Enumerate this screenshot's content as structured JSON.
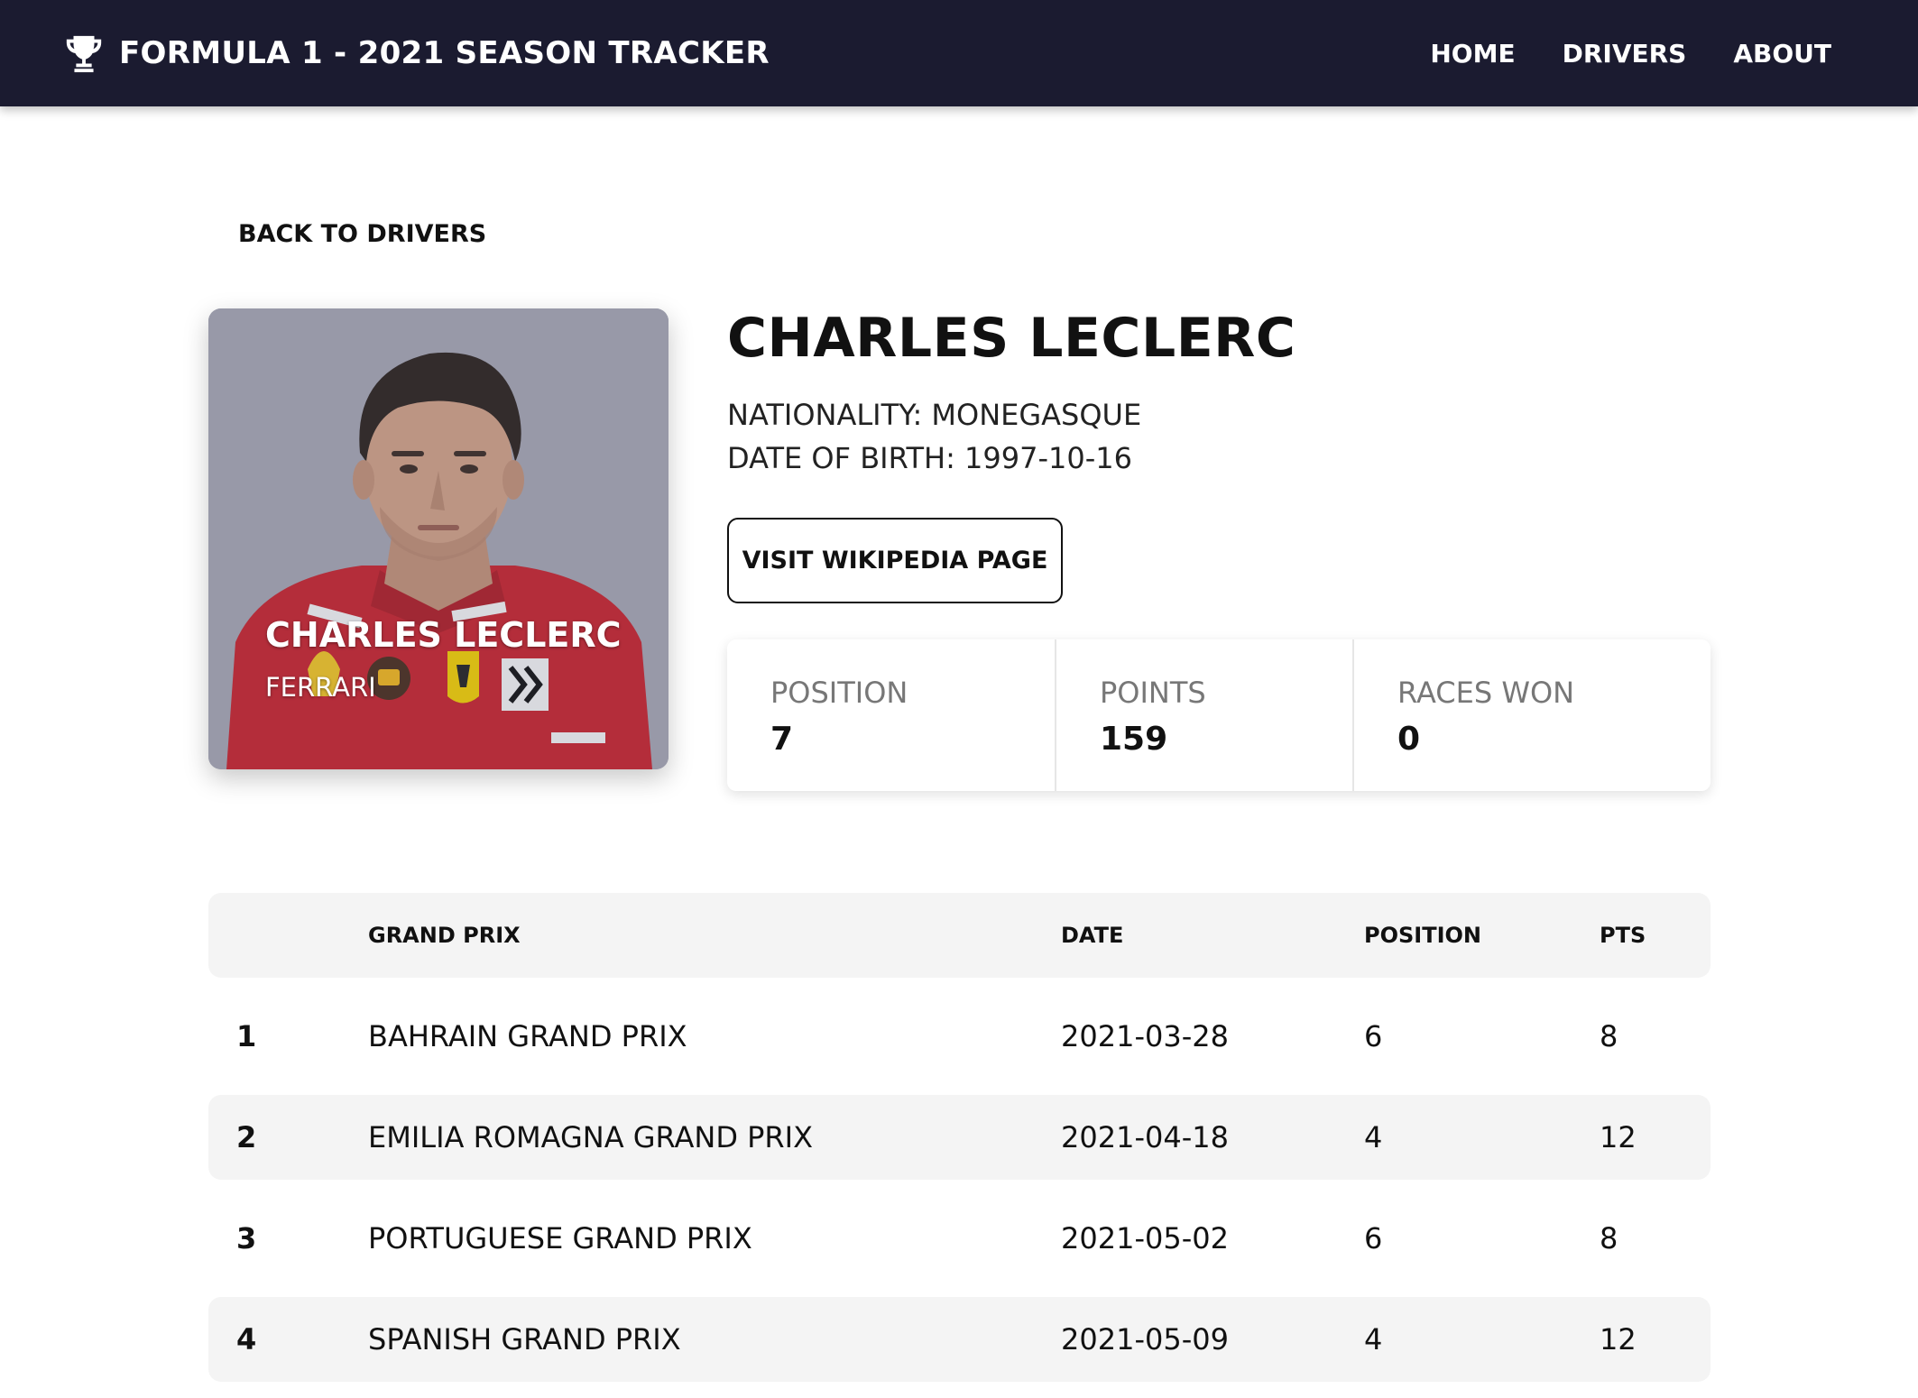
{
  "navbar": {
    "brand": "FORMULA 1 - 2021 SEASON TRACKER",
    "brand_icon": "trophy-icon",
    "links": [
      "HOME",
      "DRIVERS",
      "ABOUT"
    ]
  },
  "back_link": "BACK TO DRIVERS",
  "driver_card": {
    "name": "CHARLES LECLERC",
    "team": "FERRARI"
  },
  "driver": {
    "name": "CHARLES LECLERC",
    "nationality": "NATIONALITY: MONEGASQUE",
    "dob": "DATE OF BIRTH: 1997-10-16",
    "wiki_button": "VISIT WIKIPEDIA PAGE"
  },
  "stats": [
    {
      "label": "POSITION",
      "value": "7"
    },
    {
      "label": "POINTS",
      "value": "159"
    },
    {
      "label": "RACES WON",
      "value": "0"
    }
  ],
  "results": {
    "headers": {
      "num": "",
      "grand_prix": "GRAND PRIX",
      "date": "DATE",
      "position": "POSITION",
      "pts": "PTS"
    },
    "rows": [
      {
        "num": "1",
        "grand_prix": "BAHRAIN GRAND PRIX",
        "date": "2021-03-28",
        "position": "6",
        "pts": "8"
      },
      {
        "num": "2",
        "grand_prix": "EMILIA ROMAGNA GRAND PRIX",
        "date": "2021-04-18",
        "position": "4",
        "pts": "12"
      },
      {
        "num": "3",
        "grand_prix": "PORTUGUESE GRAND PRIX",
        "date": "2021-05-02",
        "position": "6",
        "pts": "8"
      },
      {
        "num": "4",
        "grand_prix": "SPANISH GRAND PRIX",
        "date": "2021-05-09",
        "position": "4",
        "pts": "12"
      }
    ]
  },
  "colors": {
    "navbar_bg": "#1b1b30",
    "row_alt_bg": "#f4f4f4",
    "suit_red": "#c8232c"
  }
}
